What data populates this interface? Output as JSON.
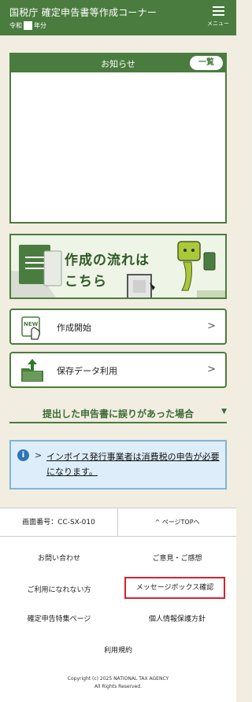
{
  "header": {
    "title": "国税庁 確定申告書等作成コーナー",
    "era_prefix": "令和",
    "era_suffix": "年分",
    "menu_label": "メニュー"
  },
  "notice": {
    "title": "お知らせ",
    "list_button": "一覧"
  },
  "banner": {
    "line1": "作成の流れは",
    "line2": "こちら"
  },
  "actions": [
    {
      "label": "作成開始",
      "icon_text": "NEW"
    },
    {
      "label": "保存データ利用"
    }
  ],
  "error_section": {
    "title": "提出した申告書に誤りがあった場合"
  },
  "info": {
    "link_text": "インボイス発行事業者は消費税の申告が必要になります。"
  },
  "footer": {
    "screen_id": "画面番号：CC-SX-010",
    "page_top": "^ ページTOPへ",
    "links": [
      "お問い合わせ",
      "ご意見・ご感想",
      "ご利用になれない方",
      "メッセージボックス確認",
      "確定申告特集ページ",
      "個人情報保護方針",
      "利用規約"
    ],
    "copyright_line1": "Copyright (c) 2025 NATIONAL TAX AGENCY",
    "copyright_line2": "All Rights Reserved."
  },
  "colors": {
    "brand_green": "#4a7c3f",
    "background": "#f1ede0",
    "info_blue": "#2f74b5",
    "highlight_red": "#d9212f"
  }
}
